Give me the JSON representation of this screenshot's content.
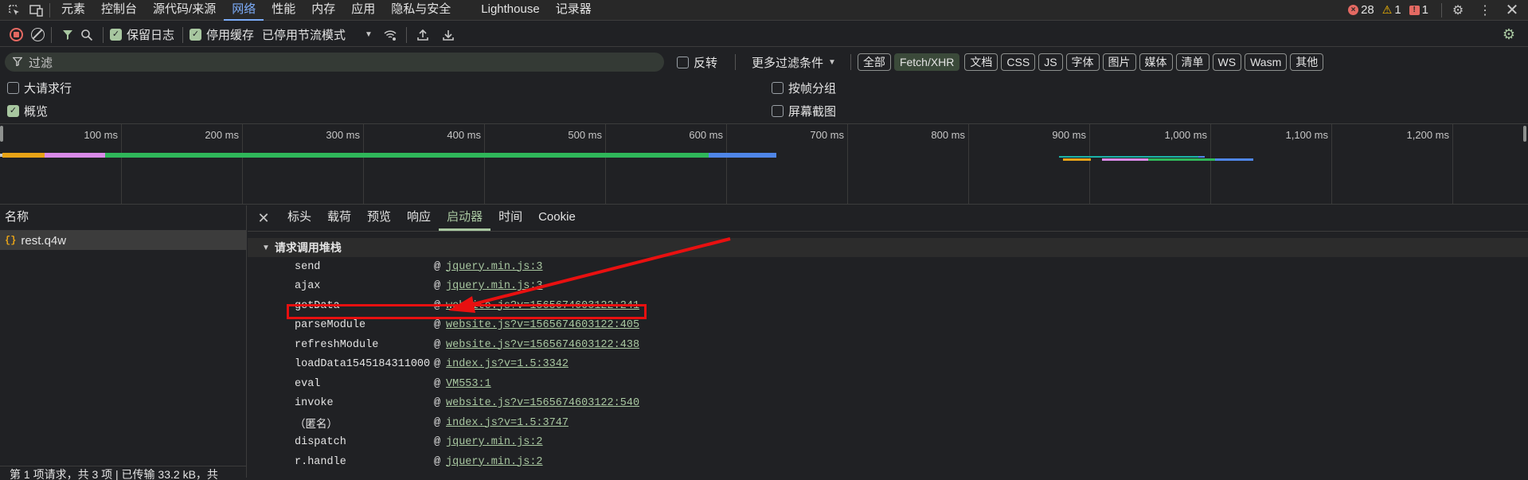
{
  "tabs": {
    "items": [
      "元素",
      "控制台",
      "源代码/来源",
      "网络",
      "性能",
      "内存",
      "应用",
      "隐私与安全",
      "Lighthouse",
      "记录器"
    ],
    "active_index": 3,
    "errors": "28",
    "warnings": "1",
    "issues": "1"
  },
  "toolbar": {
    "preserve_log": "保留日志",
    "disable_cache": "停用缓存",
    "throttle": "已停用节流模式"
  },
  "filter": {
    "placeholder": "过滤",
    "invert": "反转",
    "more_filters": "更多过滤条件",
    "types": [
      "全部",
      "Fetch/XHR",
      "文档",
      "CSS",
      "JS",
      "字体",
      "图片",
      "媒体",
      "清单",
      "WS",
      "Wasm",
      "其他"
    ],
    "selected_type": "Fetch/XHR"
  },
  "options": {
    "large_rows": "大请求行",
    "group_by_frame": "按帧分组",
    "overview": "概览",
    "screenshots": "屏幕截图"
  },
  "overview": {
    "ticks": [
      "100 ms",
      "200 ms",
      "300 ms",
      "400 ms",
      "500 ms",
      "600 ms",
      "700 ms",
      "800 ms",
      "900 ms",
      "1,000 ms",
      "1,100 ms",
      "1,200 ms"
    ]
  },
  "requests": {
    "column_name": "名称",
    "items": [
      "rest.q4w"
    ],
    "status": "第 1 项请求，共 3 项 | 已传输 33.2 kB，共"
  },
  "details": {
    "tabs": [
      "标头",
      "载荷",
      "预览",
      "响应",
      "启动器",
      "时间",
      "Cookie"
    ],
    "active_tab": "启动器",
    "section_title": "请求调用堆栈",
    "stack": [
      {
        "fn": "send",
        "link": "jquery.min.js:3"
      },
      {
        "fn": "ajax",
        "link": "jquery.min.js:3"
      },
      {
        "fn": "getData",
        "link": "website.js?v=1565674603122:241"
      },
      {
        "fn": "parseModule",
        "link": "website.js?v=1565674603122:405"
      },
      {
        "fn": "refreshModule",
        "link": "website.js?v=1565674603122:438"
      },
      {
        "fn": "loadData1545184311000",
        "link": "index.js?v=1.5:3342"
      },
      {
        "fn": "eval",
        "link": "VM553:1"
      },
      {
        "fn": "invoke",
        "link": "website.js?v=1565674603122:540"
      },
      {
        "fn": "（匿名）",
        "link": "index.js?v=1.5:3747"
      },
      {
        "fn": "dispatch",
        "link": "jquery.min.js:2"
      },
      {
        "fn": "r.handle",
        "link": "jquery.min.js:2"
      }
    ]
  },
  "colors": {
    "accent_blue": "#7cacf8",
    "accent_green": "#a8c7a0",
    "annotation_red": "#e81010",
    "bar_orange": "#e8a317",
    "bar_purple": "#d98ae8",
    "bar_green": "#2fb85a",
    "bar_blue": "#4f86e8"
  }
}
